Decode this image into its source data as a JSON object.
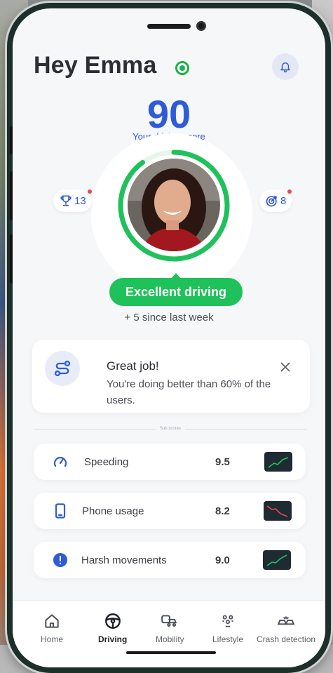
{
  "header": {
    "greeting": "Hey Emma",
    "status_icon": "online-status-icon",
    "bell_icon": "bell-icon"
  },
  "score": {
    "value": "90",
    "label": "Your driving score",
    "ring_progress": 0.9,
    "rating": "Excellent driving",
    "change": "+ 5 since last week"
  },
  "badges": {
    "trophies": {
      "icon": "trophy-icon",
      "count": "13"
    },
    "goals": {
      "icon": "target-icon",
      "count": "8"
    }
  },
  "tip_card": {
    "icon": "route-icon",
    "title": "Great job!",
    "text": "You're doing better than 60% of the users."
  },
  "subscores": {
    "title": "Sub scores",
    "items": [
      {
        "label": "Speeding",
        "value": "9.5",
        "icon": "speedometer-icon",
        "trend": "up"
      },
      {
        "label": "Phone usage",
        "value": "8.2",
        "icon": "phone-icon",
        "trend": "down"
      },
      {
        "label": "Harsh movements",
        "value": "9.0",
        "icon": "alert-icon",
        "trend": "up"
      }
    ]
  },
  "nav": {
    "items": [
      {
        "label": "Home",
        "icon": "home-icon"
      },
      {
        "label": "Driving",
        "icon": "steering-wheel-icon"
      },
      {
        "label": "Mobility",
        "icon": "mobility-icon"
      },
      {
        "label": "Lifestyle",
        "icon": "lifestyle-icon"
      },
      {
        "label": "Crash detection",
        "icon": "crash-icon"
      }
    ]
  },
  "colors": {
    "primary_blue": "#2f5bd8",
    "success_green": "#1ec15a",
    "alert_red": "#e54b4b"
  }
}
